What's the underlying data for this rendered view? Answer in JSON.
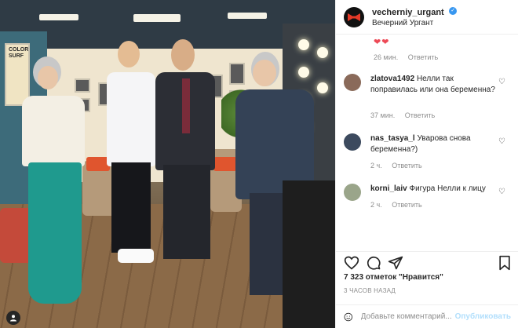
{
  "post": {
    "username": "vecherniy_urgant",
    "subtitle": "Вечерний Ургант",
    "hearts": "❤❤",
    "caption_time": "26 мин.",
    "reply_label": "Ответить",
    "likes_text": "7 323 отметок \"Нравится\"",
    "posted_ago": "3 ЧАСОВ НАЗАД"
  },
  "poster_sign": "COLOR SURF",
  "comments": [
    {
      "user": "zlatova1492",
      "text": "Нелли так поправилась или она беременна?",
      "time": "37 мин.",
      "reply": "Ответить"
    },
    {
      "user": "nas_tasya_l",
      "text": "Уварова снова беременна?)",
      "time": "2 ч.",
      "reply": "Ответить"
    },
    {
      "user": "korni_laiv",
      "text": "Фигура Нелли к лицу",
      "time": "2 ч.",
      "reply": "Ответить"
    }
  ],
  "comment_bar": {
    "placeholder": "Добавьте комментарий...",
    "post_label": "Опубликовать"
  },
  "colors": {
    "verified": "#3897f0",
    "heart": "#ed4956",
    "post_button_disabled": "#b2dffc"
  },
  "icons": [
    "bowtie-logo-icon",
    "verified-badge-icon",
    "heart-icon",
    "comment-icon",
    "share-icon",
    "bookmark-icon",
    "emoji-icon",
    "user-tag-icon"
  ]
}
